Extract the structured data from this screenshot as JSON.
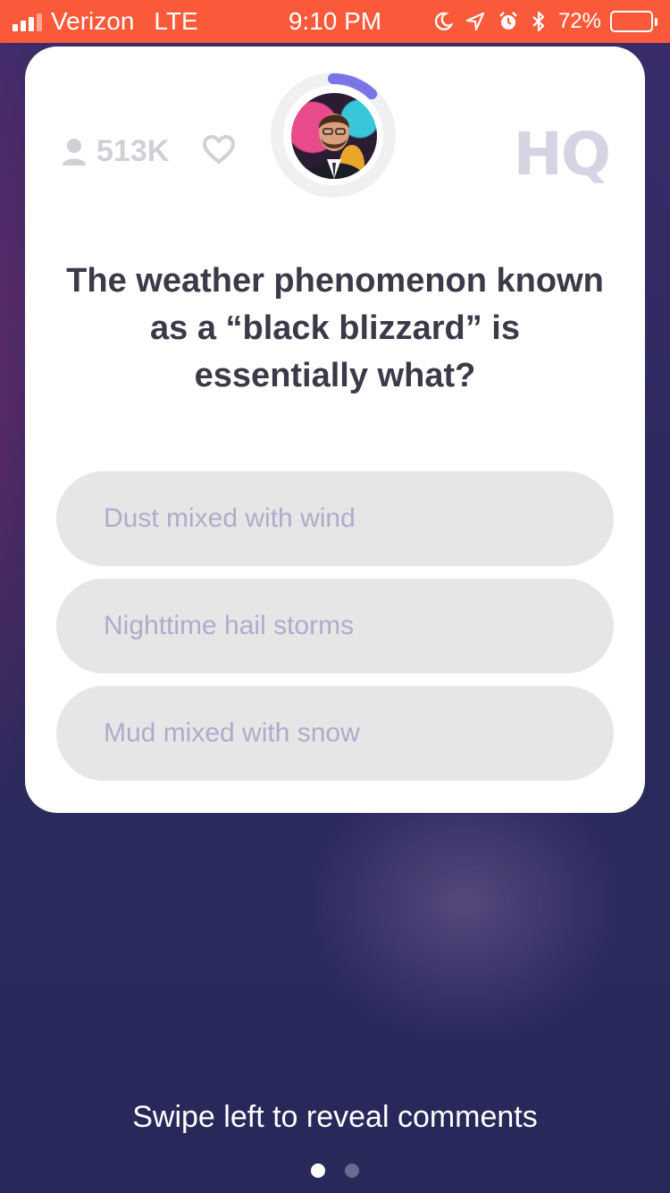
{
  "status_bar": {
    "carrier": "Verizon",
    "network": "LTE",
    "time": "9:10 PM",
    "battery": "72%",
    "battery_level": 0.72,
    "icons": [
      "moon-icon",
      "location-arrow-icon",
      "alarm-icon",
      "bluetooth-icon"
    ],
    "bar_color": "#fb5a3a"
  },
  "game": {
    "viewer_count": "513K",
    "logo": "HQ",
    "timer_progress": 0.12,
    "question": "The weather phenomenon known as a “black blizzard” is essentially what?",
    "answers": [
      "Dust mixed with wind",
      "Nighttime hail storms",
      "Mud mixed with snow"
    ]
  },
  "footer": {
    "swipe_hint": "Swipe left to reveal comments",
    "page_count": 2,
    "active_page": 1
  },
  "colors": {
    "card": "#ffffff",
    "answer_pill": "#e6e6e6",
    "answer_text": "#aeaccc",
    "timer_accent": "#7a74e8",
    "background": "#2c2a5e"
  }
}
